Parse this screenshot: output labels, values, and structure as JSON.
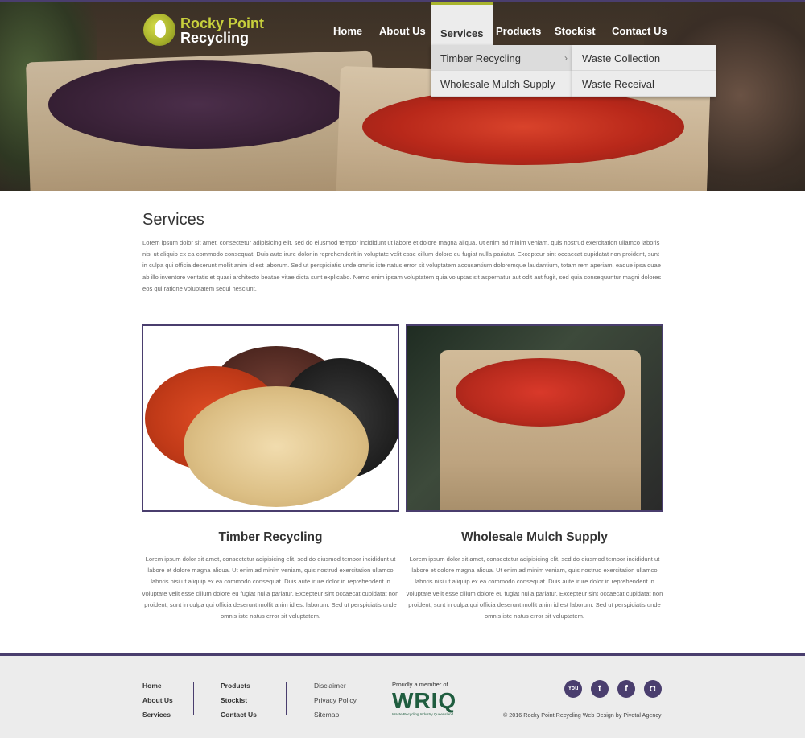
{
  "header": {
    "logo_line1": "Rocky Point",
    "logo_line2": "Recycling"
  },
  "nav": {
    "items": [
      "Home",
      "About Us",
      "Services",
      "Products",
      "Stockist",
      "Contact Us"
    ],
    "active": "Services"
  },
  "dropdown": {
    "items": [
      "Timber Recycling",
      "Wholesale Mulch Supply"
    ],
    "submenu": [
      "Waste Collection",
      "Waste Receival"
    ]
  },
  "main": {
    "title": "Services",
    "intro": "Lorem ipsum dolor sit amet, consectetur adipisicing elit, sed do eiusmod tempor incididunt ut labore et dolore magna aliqua. Ut enim ad minim veniam, quis nostrud exercitation ullamco laboris nisi ut aliquip ex ea commodo consequat. Duis aute irure dolor in reprehenderit in voluptate velit esse cillum dolore eu fugiat nulla pariatur. Excepteur sint occaecat cupidatat non proident, sunt in culpa qui officia deserunt mollit anim id est laborum. Sed ut perspiciatis unde omnis iste natus error sit voluptatem accusantium doloremque laudantium, totam rem aperiam, eaque ipsa quae ab illo inventore veritatis et quasi architecto beatae vitae dicta sunt explicabo. Nemo enim ipsam voluptatem quia voluptas sit aspernatur aut odit aut fugit, sed quia consequuntur magni dolores eos qui ratione voluptatem sequi nesciunt.",
    "columns": [
      {
        "title": "Timber Recycling",
        "text": "Lorem ipsum dolor sit amet, consectetur adipisicing elit, sed do eiusmod tempor incididunt ut labore et dolore magna aliqua. Ut enim ad minim veniam, quis nostrud exercitation ullamco laboris nisi ut aliquip ex ea commodo consequat. Duis aute irure dolor in reprehenderit in voluptate velit esse cillum dolore eu fugiat nulla pariatur. Excepteur sint occaecat cupidatat non proident, sunt in culpa qui officia deserunt mollit anim id est laborum. Sed ut perspiciatis unde omnis iste natus error sit voluptatem."
      },
      {
        "title": "Wholesale Mulch Supply",
        "text": "Lorem ipsum dolor sit amet, consectetur adipisicing elit, sed do eiusmod tempor incididunt ut labore et dolore magna aliqua. Ut enim ad minim veniam, quis nostrud exercitation ullamco laboris nisi ut aliquip ex ea commodo consequat. Duis aute irure dolor in reprehenderit in voluptate velit esse cillum dolore eu fugiat nulla pariatur. Excepteur sint occaecat cupidatat non proident, sunt in culpa qui officia deserunt mollit anim id est laborum. Sed ut perspiciatis unde omnis iste natus error sit voluptatem."
      }
    ]
  },
  "footer": {
    "col1": [
      "Home",
      "About Us",
      "Services"
    ],
    "col2": [
      "Products",
      "Stockist",
      "Contact Us"
    ],
    "col3": [
      "Disclaimer",
      "Privacy Policy",
      "Sitemap"
    ],
    "member_label": "Proudly a member of",
    "wriq_logo": "WRIQ",
    "wriq_sub": "Waste Recycling Industry Queensland",
    "social_icons": [
      "youtube-icon",
      "twitter-icon",
      "facebook-icon",
      "instagram-icon"
    ],
    "social_glyphs": [
      "You",
      "t",
      "f",
      "◘"
    ],
    "copyright": "© 2016 Rocky Point Recycling Web Design by Pivotal Agency"
  },
  "colors": {
    "accent_purple": "#4a3e6e",
    "logo_green": "#c7cf3c",
    "wriq_green": "#1f5d3f"
  }
}
